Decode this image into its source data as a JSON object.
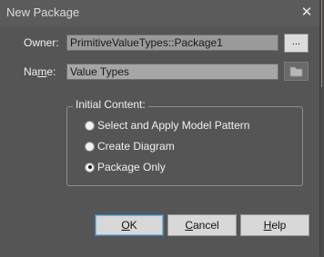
{
  "window": {
    "title": "New Package",
    "close_glyph": "✕"
  },
  "owner": {
    "label": "Owner:",
    "value": "PrimitiveValueTypes::Package1",
    "browse_label": "..."
  },
  "name": {
    "label_pre": "Na",
    "label_u": "m",
    "label_post": "e:",
    "value": "Value Types",
    "folder_icon": "folder-icon"
  },
  "initial_content": {
    "legend": "Initial Content:",
    "options": [
      {
        "label": "Select and Apply Model Pattern",
        "checked": false
      },
      {
        "label": "Create Diagram",
        "checked": false
      },
      {
        "label": "Package Only",
        "checked": true
      }
    ]
  },
  "buttons": {
    "ok": {
      "u": "O",
      "rest": "K"
    },
    "cancel": {
      "u": "C",
      "rest": "ancel"
    },
    "help": {
      "u": "H",
      "rest": "elp"
    }
  },
  "colors": {
    "background": "#555555",
    "field": "#9a9a9a",
    "button": "#d8d8d8",
    "accent": "#3c7fb1"
  }
}
